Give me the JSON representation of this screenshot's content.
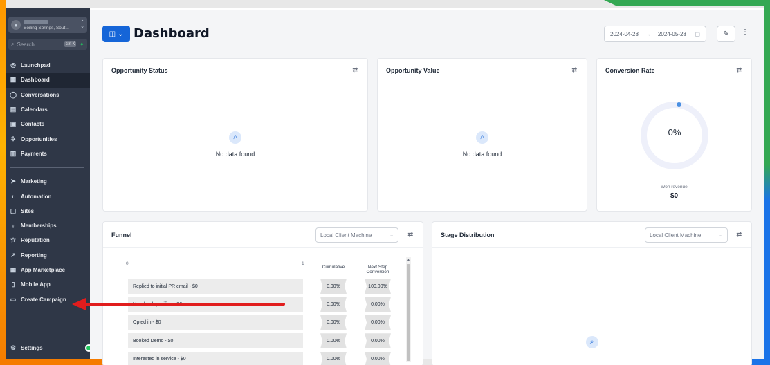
{
  "sidebar": {
    "account_location": "Boiling Springs, Sout...",
    "search_placeholder": "Search",
    "search_shortcut": "ctrl K",
    "items_top": [
      {
        "label": "Launchpad",
        "icon": "rocket-icon",
        "glyph": "◎"
      },
      {
        "label": "Dashboard",
        "icon": "dashboard-icon",
        "glyph": "▦"
      },
      {
        "label": "Conversations",
        "icon": "chat-icon",
        "glyph": "◯"
      },
      {
        "label": "Calendars",
        "icon": "calendar-icon",
        "glyph": "▤"
      },
      {
        "label": "Contacts",
        "icon": "contacts-icon",
        "glyph": "▣"
      },
      {
        "label": "Opportunities",
        "icon": "opportunities-icon",
        "glyph": "✲"
      },
      {
        "label": "Payments",
        "icon": "payments-icon",
        "glyph": "▥"
      }
    ],
    "items_bottom": [
      {
        "label": "Marketing",
        "icon": "send-icon",
        "glyph": "➤"
      },
      {
        "label": "Automation",
        "icon": "automation-icon",
        "glyph": "◐"
      },
      {
        "label": "Sites",
        "icon": "sites-icon",
        "glyph": "▢"
      },
      {
        "label": "Memberships",
        "icon": "memberships-icon",
        "glyph": "♁"
      },
      {
        "label": "Reputation",
        "icon": "star-icon",
        "glyph": "☆"
      },
      {
        "label": "Reporting",
        "icon": "chart-line-icon",
        "glyph": "↗"
      },
      {
        "label": "App Marketplace",
        "icon": "apps-icon",
        "glyph": "▦"
      },
      {
        "label": "Mobile App",
        "icon": "mobile-icon",
        "glyph": "▯"
      },
      {
        "label": "Create Campaign",
        "icon": "campaign-icon",
        "glyph": "▭"
      }
    ],
    "settings_label": "Settings"
  },
  "header": {
    "title": "Dashboard",
    "date_start": "2024-04-28",
    "date_sep": "→",
    "date_end": "2024-05-28"
  },
  "cards": {
    "opportunity_status": {
      "title": "Opportunity Status",
      "empty": "No data found"
    },
    "opportunity_value": {
      "title": "Opportunity Value",
      "empty": "No data found"
    },
    "conversion_rate": {
      "title": "Conversion Rate",
      "value": "0%",
      "won_label": "Won revenue",
      "won_value": "$0"
    },
    "funnel": {
      "title": "Funnel",
      "select": "Local Client Machine",
      "axis_min": "0",
      "axis_max": "1",
      "col_cumulative": "Cumulative",
      "col_next": "Next Step Conversion",
      "rows": [
        {
          "label": "Replied to initial PR email - $0",
          "cum": "0.00%",
          "next": "100.00%"
        },
        {
          "label": "New lead qualified - $0",
          "cum": "0.00%",
          "next": "0.00%"
        },
        {
          "label": "Opted in - $0",
          "cum": "0.00%",
          "next": "0.00%"
        },
        {
          "label": "Booked Demo - $0",
          "cum": "0.00%",
          "next": "0.00%"
        },
        {
          "label": "Interested in service - $0",
          "cum": "0.00%",
          "next": "0.00%"
        }
      ]
    },
    "stage_distribution": {
      "title": "Stage Distribution",
      "select": "Local Client Machine"
    }
  },
  "colors": {
    "accent": "#1565d8",
    "sidebar": "#2f3747",
    "annotation": "#e11d1d"
  }
}
